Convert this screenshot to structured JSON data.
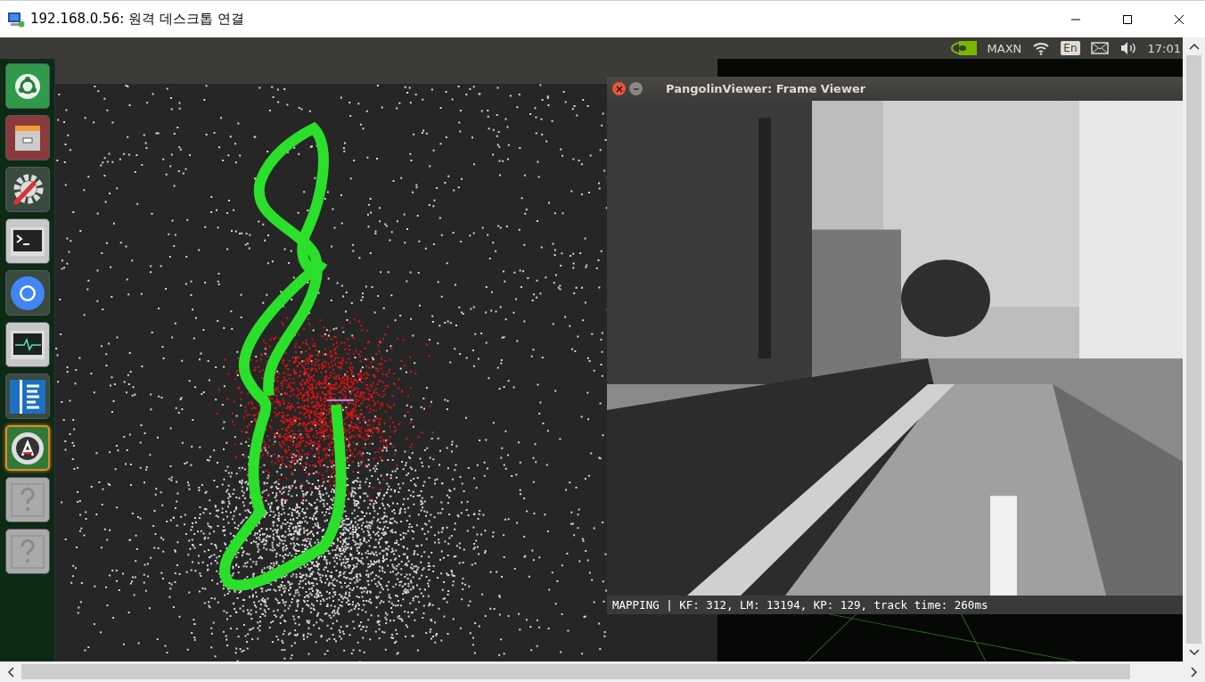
{
  "window": {
    "title": "192.168.0.56: 원격 데스크톱 연결"
  },
  "top_panel": {
    "power_mode": "MAXN",
    "keyboard": "En",
    "clock": "17:01"
  },
  "launcher": {
    "items": [
      {
        "kind": "home",
        "urgent": false
      },
      {
        "kind": "files",
        "urgent": false
      },
      {
        "kind": "settings",
        "urgent": false
      },
      {
        "kind": "terminal",
        "urgent": false
      },
      {
        "kind": "browser",
        "urgent": false
      },
      {
        "kind": "monitor",
        "urgent": false
      },
      {
        "kind": "document",
        "urgent": false
      },
      {
        "kind": "updater",
        "urgent": true
      },
      {
        "kind": "unknown",
        "urgent": false
      },
      {
        "kind": "unknown",
        "urgent": false
      }
    ]
  },
  "frame_viewer": {
    "title": "PangolinViewer: Frame Viewer",
    "status": "MAPPING | KF: 312, LM: 13194, KP: 129, track time: 260ms"
  }
}
